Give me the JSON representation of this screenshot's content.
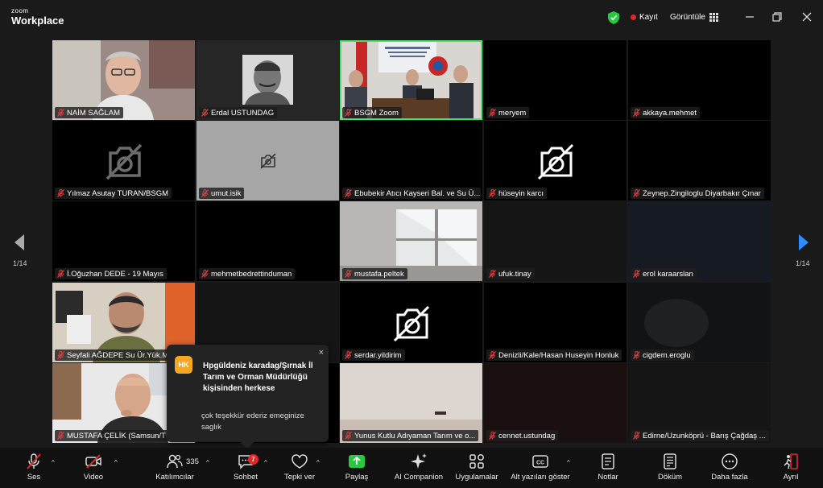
{
  "app": {
    "brand_small": "zoom",
    "brand_big": "Workplace"
  },
  "header": {
    "recording_label": "Kayıt",
    "view_label": "Görüntüle"
  },
  "pager": {
    "left": "1/14",
    "right": "1/14"
  },
  "participants": [
    {
      "name": "NAİM SAĞLAM",
      "video": "face-glasses"
    },
    {
      "name": "Erdal USTUNDAG",
      "video": "photo"
    },
    {
      "name": "BSGM Zoom",
      "video": "meeting-room",
      "active": true
    },
    {
      "name": "meryem",
      "video": "black"
    },
    {
      "name": "akkaya.mehmet",
      "video": "black"
    },
    {
      "name": "Yılmaz Asutay TURAN/BSGM",
      "video": "cam-off-blur"
    },
    {
      "name": "umut.isik",
      "video": "cam-off-small"
    },
    {
      "name": "Ebubekir Atıcı Kayseri Bal. ve Su Ü...",
      "video": "black"
    },
    {
      "name": "hüseyin karcı",
      "video": "cam-off"
    },
    {
      "name": "Zeynep.Zingiloglu Diyarbakır Çınar",
      "video": "black"
    },
    {
      "name": "İ.Oğuzhan DEDE - 19 Mayıs",
      "video": "black"
    },
    {
      "name": "mehmetbedrettinduman",
      "video": "black"
    },
    {
      "name": "mustafa.peltek",
      "video": "window"
    },
    {
      "name": "ufuk.tinay",
      "video": "dark"
    },
    {
      "name": "erol karaarslan",
      "video": "dark-blue"
    },
    {
      "name": "Seyfali AĞDEPE Su Ür.Yük.M",
      "video": "face-beard"
    },
    {
      "name": "",
      "video": "dark"
    },
    {
      "name": "serdar.yildirim",
      "video": "cam-off"
    },
    {
      "name": "Denizli/Kale/Hasan Huseyin Honluk",
      "video": "black"
    },
    {
      "name": "cigdem.eroglu",
      "video": "dark-blur"
    },
    {
      "name": "MUSTAFA ÇELİK (Samsun/T",
      "video": "face-bald"
    },
    {
      "name": "",
      "video": "black"
    },
    {
      "name": "Yunus Kutlu Adıyaman Tarım ve o...",
      "video": "wall"
    },
    {
      "name": "cennet.ustundag",
      "video": "dark-red"
    },
    {
      "name": "Edirne/Uzunköprü - Barış Çağdaş ...",
      "video": "dark"
    }
  ],
  "chat_popup": {
    "avatar": "HK",
    "sender": "Hpgüldeniz karadag/Şırnak İl Tarım ve Orman Müdürlüğü kişisinden herkese",
    "message": "çok teşekkür ederiz emeginize saglık",
    "close": "×"
  },
  "toolbar": {
    "audio": "Ses",
    "video": "Video",
    "participants": "Katılımcılar",
    "participants_count": "335",
    "chat": "Sohbet",
    "chat_badge": "7",
    "react": "Tepki ver",
    "share": "Paylaş",
    "ai": "AI Companion",
    "apps": "Uygulamalar",
    "captions": "Alt yazıları göster",
    "notes": "Notlar",
    "docs": "Döküm",
    "more": "Daha fazla",
    "leave": "Ayrıl"
  },
  "colors": {
    "active_border": "#4ae36a",
    "share_green": "#28c840",
    "record_red": "#e02828",
    "badge_orange": "#f5a623",
    "accent_blue": "#2d8cff"
  }
}
